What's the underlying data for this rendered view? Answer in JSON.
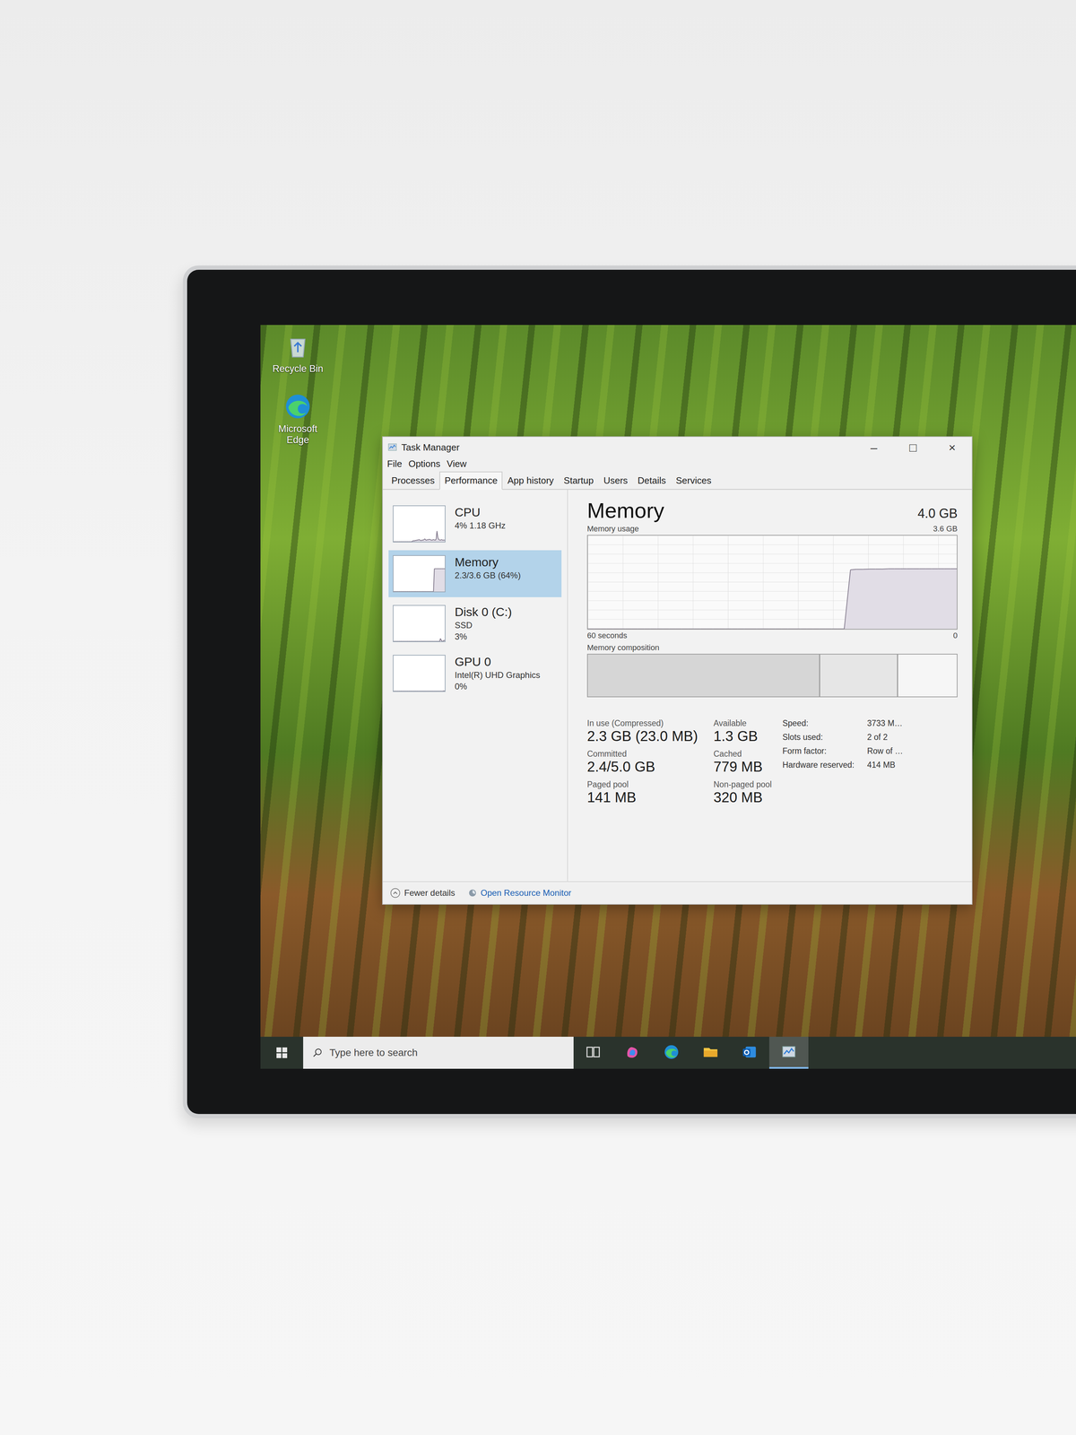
{
  "desktop": {
    "icons": [
      {
        "label": "Recycle Bin",
        "kind": "bin"
      },
      {
        "label": "Microsoft Edge",
        "kind": "edge"
      }
    ]
  },
  "window": {
    "title": "Task Manager",
    "controls": [
      "–",
      "□",
      "×"
    ]
  },
  "menu": [
    "File",
    "Options",
    "View"
  ],
  "tabs": [
    {
      "label": "Processes",
      "selected": false
    },
    {
      "label": "Performance",
      "selected": true
    },
    {
      "label": "App history",
      "selected": false
    },
    {
      "label": "Startup",
      "selected": false
    },
    {
      "label": "Users",
      "selected": false
    },
    {
      "label": "Details",
      "selected": false
    },
    {
      "label": "Services",
      "selected": false
    }
  ],
  "sidebar": {
    "items": [
      {
        "name": "CPU",
        "lines": [
          "4% 1.18 GHz"
        ],
        "selected": false,
        "graph": [
          0,
          0,
          0,
          0,
          0,
          0,
          0,
          0,
          0,
          0,
          0,
          0,
          0,
          0,
          0,
          0,
          0,
          0,
          0,
          0,
          0,
          0,
          2,
          3,
          2,
          4,
          3,
          5,
          4,
          6,
          5,
          4,
          3,
          5,
          4,
          6,
          8,
          5,
          4,
          6,
          5,
          7,
          6,
          5,
          4,
          5,
          6,
          5,
          4,
          7,
          30,
          12,
          6,
          5,
          4,
          6,
          5,
          4,
          5,
          4
        ]
      },
      {
        "name": "Memory",
        "lines": [
          "2.3/3.6 GB (64%)"
        ],
        "selected": true,
        "graph": [
          0,
          0,
          0,
          0,
          0,
          0,
          0,
          0,
          0,
          0,
          0,
          0,
          0,
          0,
          0,
          0,
          0,
          0,
          0,
          0,
          0,
          0,
          0,
          0,
          0,
          0,
          0,
          0,
          0,
          0,
          0,
          0,
          0,
          0,
          0,
          0,
          0,
          0,
          0,
          0,
          0,
          0,
          0,
          0,
          0,
          0,
          0,
          64,
          64,
          64,
          64,
          64,
          64,
          64,
          64,
          64,
          64,
          64,
          64,
          64
        ]
      },
      {
        "name": "Disk 0 (C:)",
        "lines": [
          "SSD",
          "3%"
        ],
        "selected": false,
        "graph": [
          0,
          0,
          0,
          0,
          0,
          0,
          0,
          0,
          0,
          0,
          0,
          0,
          0,
          0,
          0,
          0,
          0,
          0,
          0,
          0,
          0,
          0,
          0,
          0,
          0,
          0,
          0,
          0,
          0,
          0,
          0,
          0,
          0,
          0,
          0,
          0,
          0,
          0,
          0,
          0,
          0,
          0,
          0,
          0,
          0,
          0,
          0,
          0,
          0,
          0,
          0,
          0,
          0,
          0,
          8,
          3,
          0,
          0,
          3,
          2
        ]
      },
      {
        "name": "GPU 0",
        "lines": [
          "Intel(R) UHD Graphics",
          "0%"
        ],
        "selected": false,
        "graph": [
          0,
          0,
          0,
          0,
          0,
          0,
          0,
          0,
          0,
          0,
          0,
          0,
          0,
          0,
          0,
          0,
          0,
          0,
          0,
          0,
          0,
          0,
          0,
          0,
          0,
          0,
          0,
          0,
          0,
          0,
          0,
          0,
          0,
          0,
          0,
          0,
          0,
          0,
          0,
          0,
          0,
          0,
          0,
          0,
          0,
          0,
          0,
          0,
          0,
          0,
          0,
          0,
          0,
          0,
          0,
          0,
          0,
          0,
          1,
          0
        ]
      }
    ]
  },
  "panel": {
    "title": "Memory",
    "total": "4.0 GB",
    "usage_label": "Memory usage",
    "usage_max": "3.6 GB",
    "chart": {
      "max": 3.6,
      "x_start": "60 seconds",
      "x_end": "0",
      "values": [
        0,
        0,
        0,
        0,
        0,
        0,
        0,
        0,
        0,
        0,
        0,
        0,
        0,
        0,
        0,
        0,
        0,
        0,
        0,
        0,
        0,
        0,
        0,
        0,
        0,
        0,
        0,
        0,
        0,
        0,
        0,
        0,
        0,
        0,
        0,
        0,
        0,
        0,
        0,
        0,
        0,
        0,
        2.28,
        2.3,
        2.3,
        2.31,
        2.31,
        2.31,
        2.32,
        2.32,
        2.32,
        2.32,
        2.32,
        2.32,
        2.32,
        2.32,
        2.32,
        2.32,
        2.32,
        2.32
      ]
    },
    "composition_label": "Memory composition",
    "composition": [
      {
        "level": 0.63
      },
      {
        "level": 0.21
      },
      {
        "level": 0.16
      }
    ],
    "stats": [
      {
        "label": "In use (Compressed)",
        "value": "2.3 GB (23.0 MB)"
      },
      {
        "label": "Available",
        "value": "1.3 GB"
      },
      {
        "label": "Committed",
        "value": "2.4/5.0 GB"
      },
      {
        "label": "Cached",
        "value": "779 MB"
      },
      {
        "label": "Paged pool",
        "value": "141 MB"
      },
      {
        "label": "Non-paged pool",
        "value": "320 MB"
      }
    ],
    "specs": [
      {
        "label": "Speed:",
        "value": "3733 M…"
      },
      {
        "label": "Slots used:",
        "value": "2 of 2"
      },
      {
        "label": "Form factor:",
        "value": "Row of …"
      },
      {
        "label": "Hardware reserved:",
        "value": "414 MB"
      }
    ]
  },
  "footer": {
    "fewer": "Fewer details",
    "monitor": "Open Resource Monitor"
  },
  "taskbar": {
    "search_placeholder": "Type here to search",
    "apps": [
      {
        "kind": "taskview",
        "selected": false
      },
      {
        "kind": "copilot",
        "selected": false
      },
      {
        "kind": "edge",
        "selected": false
      },
      {
        "kind": "explorer",
        "selected": false
      },
      {
        "kind": "outlook",
        "selected": false
      },
      {
        "kind": "taskmgr",
        "selected": true
      }
    ]
  }
}
